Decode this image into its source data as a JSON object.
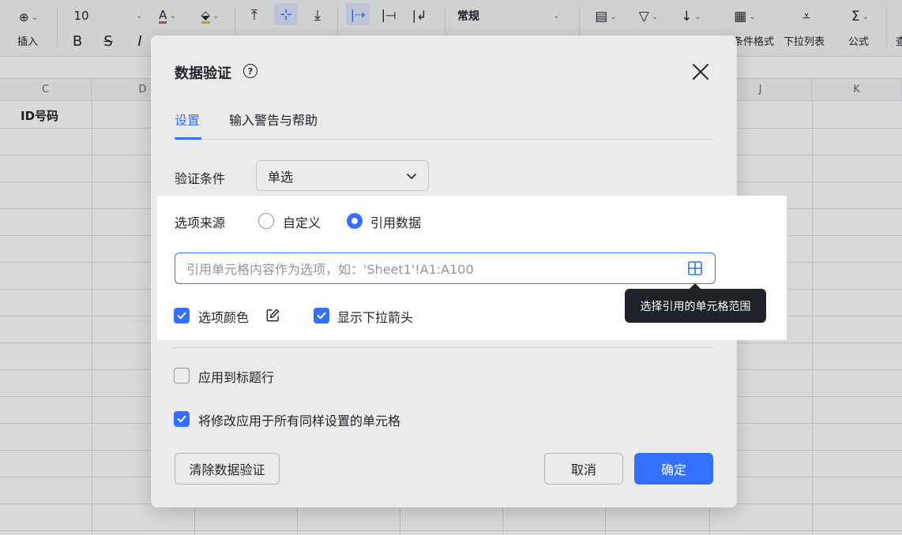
{
  "toolbar": {
    "font_size": "10",
    "insert_label": "插入",
    "bold": "B",
    "strike": "S",
    "italic": "I",
    "number_format": "常规",
    "cond_format_label": "条件格式",
    "dropdown_list_label": "下拉列表",
    "formula_label": "公式",
    "cut_off_label": "查"
  },
  "sheet": {
    "columns": [
      "C",
      "D",
      "J",
      "K"
    ],
    "cell_c1": "ID号码"
  },
  "dialog": {
    "title": "数据验证",
    "help_glyph": "?",
    "tabs": [
      "设置",
      "输入警告与帮助"
    ],
    "condition_label": "验证条件",
    "condition_value": "单选",
    "source_label": "选项来源",
    "source_options": [
      "自定义",
      "引用数据"
    ],
    "ref_placeholder": "引用单元格内容作为选项，如：'Sheet1'!A1:A100",
    "option_color_label": "选项颜色",
    "show_arrow_label": "显示下拉箭头",
    "tooltip": "选择引用的单元格范围",
    "apply_header_label": "应用到标题行",
    "apply_all_label": "将修改应用于所有同样设置的单元格",
    "clear_button": "清除数据验证",
    "cancel_button": "取消",
    "confirm_button": "确定"
  },
  "colors": {
    "accent": "#3370ff",
    "tooltip_bg": "#1f2329"
  }
}
